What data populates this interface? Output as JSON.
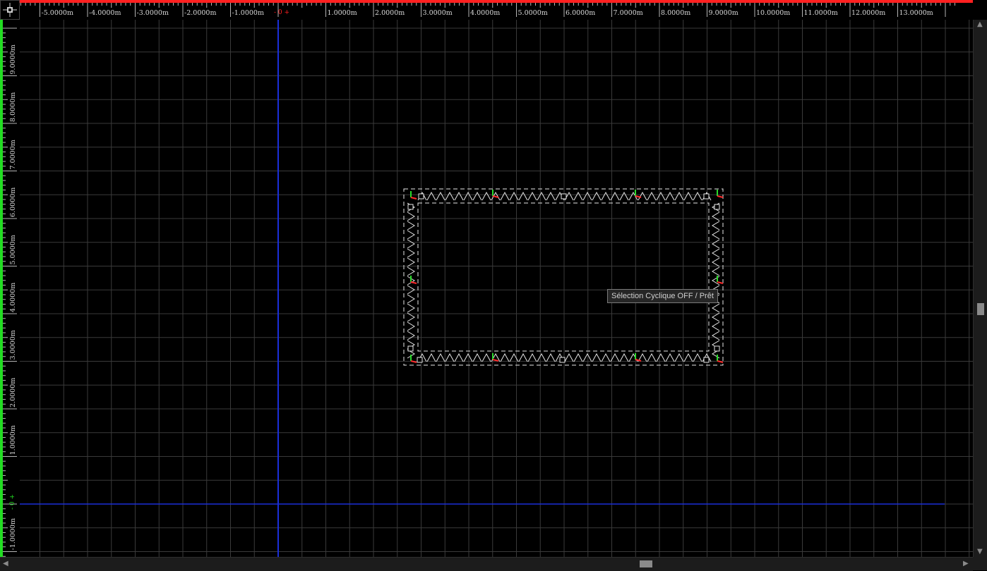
{
  "ruler_x": {
    "labels": [
      "-5.0000m",
      "-4.0000m",
      "-3.0000m",
      "-2.0000m",
      "-1.0000m",
      "0",
      "1.0000m",
      "2.0000m",
      "3.0000m",
      "4.0000m",
      "5.0000m",
      "6.0000m",
      "7.0000m",
      "8.0000m",
      "9.0000m",
      "10.0000m",
      "11.0000m",
      "12.0000m",
      "13.0000m"
    ],
    "origin_label": "0",
    "axis_color": "#ff2020"
  },
  "ruler_y": {
    "labels": [
      "9.0000m",
      "8.0000m",
      "7.0000m",
      "6.0000m",
      "5.0000m",
      "4.0000m",
      "3.0000m",
      "2.0000m",
      "1.0000m",
      "0",
      "-1.0000m"
    ],
    "origin_label": "0",
    "axis_color": "#22dd22"
  },
  "canvas": {
    "background": "#000000",
    "grid_color": "#3a3a3a",
    "origin_axis_color": "#1a2fd8"
  },
  "truss": {
    "color": "#e8e8e8",
    "marker_red": "#ff2a2a",
    "marker_green": "#2adb2a"
  },
  "status": {
    "text": "Sélection Cyclique OFF / Prêt"
  },
  "icons": {
    "corner": "crosshair-icon",
    "scroll_up": "arrow-up-icon",
    "scroll_down": "arrow-down-icon",
    "scroll_left": "arrow-left-icon",
    "scroll_right": "arrow-right-icon"
  }
}
